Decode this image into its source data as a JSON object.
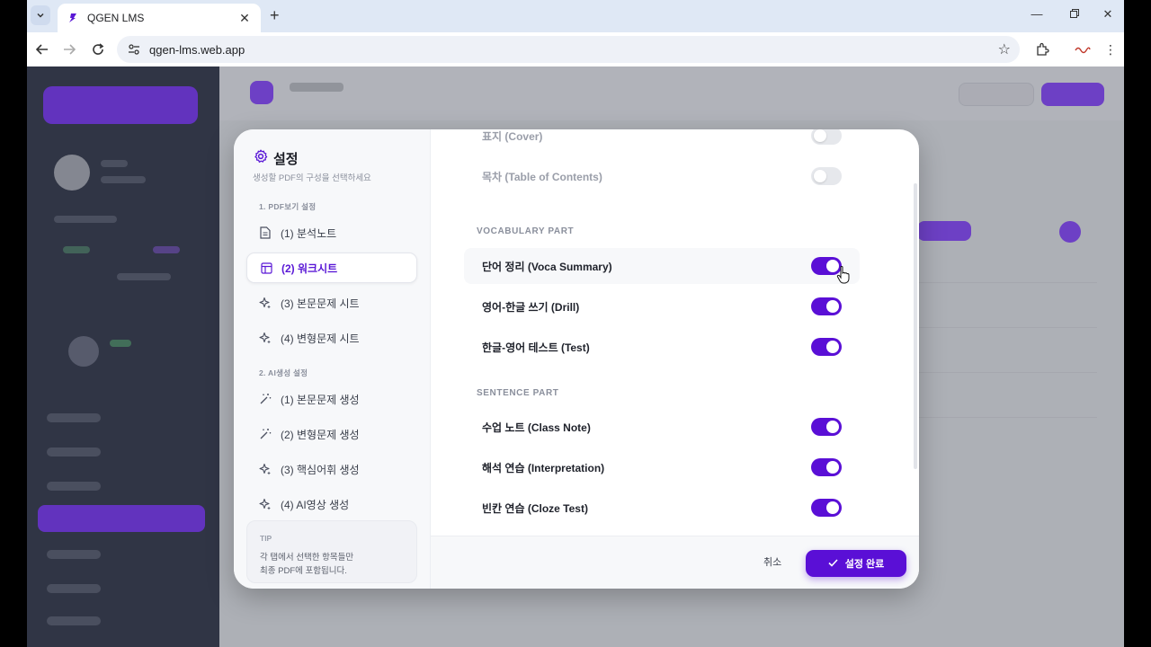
{
  "browser": {
    "tab_title": "QGEN LMS",
    "url": "qgen-lms.web.app",
    "icons": [
      "tab-search-icon",
      "close-icon",
      "new-tab-icon",
      "minimize-icon",
      "maximize-icon",
      "window-close-icon",
      "back-icon",
      "forward-icon",
      "reload-icon",
      "site-info-icon",
      "star-icon",
      "extensions-icon",
      "profile-icon",
      "more-icon"
    ]
  },
  "modal": {
    "title": "설정",
    "subtitle": "생성할 PDF의 구성을 선택하세요",
    "sidebar": {
      "section1": "1. PDF보기 설정",
      "section1_items": [
        {
          "label": "(1) 분석노트",
          "icon": "document-icon"
        },
        {
          "label": "(2) 워크시트",
          "icon": "layout-icon",
          "active": true
        },
        {
          "label": "(3) 본문문제 시트",
          "icon": "sparkle-icon"
        },
        {
          "label": "(4) 변형문제 시트",
          "icon": "sparkle-icon"
        }
      ],
      "section2": "2. AI생성 설정",
      "section2_items": [
        {
          "label": "(1) 본문문제 생성",
          "icon": "magic-wand-icon"
        },
        {
          "label": "(2) 변형문제 생성",
          "icon": "magic-wand-icon"
        },
        {
          "label": "(3) 핵심어휘 생성",
          "icon": "sparkle-icon"
        },
        {
          "label": "(4) AI영상 생성",
          "icon": "sparkle-icon"
        }
      ],
      "tip_label": "TIP",
      "tip_line1": "각 탭에서 선택한 항목들만",
      "tip_line2": "최종 PDF에 포함됩니다."
    },
    "options": {
      "cover": {
        "label": "표지 (Cover)",
        "enabled": false
      },
      "toc": {
        "label": "목차 (Table of Contents)",
        "enabled": false
      },
      "vocab_heading": "VOCABULARY PART",
      "voca_summary": {
        "label": "단어 정리 (Voca Summary)",
        "enabled": true
      },
      "drill": {
        "label": "영어-한글 쓰기 (Drill)",
        "enabled": true
      },
      "test": {
        "label": "한글-영어 테스트 (Test)",
        "enabled": true
      },
      "sentence_heading": "SENTENCE PART",
      "class_note": {
        "label": "수업 노트 (Class Note)",
        "enabled": true
      },
      "interpretation": {
        "label": "해석 연습 (Interpretation)",
        "enabled": true
      },
      "cloze": {
        "label": "빈칸 연습 (Cloze Test)",
        "enabled": true
      }
    },
    "footer": {
      "cancel": "취소",
      "confirm": "설정 완료"
    }
  },
  "colors": {
    "accent": "#5a0fd6",
    "sidebar_bg": "#161b2e",
    "toggle_off": "#e6e8ec"
  }
}
